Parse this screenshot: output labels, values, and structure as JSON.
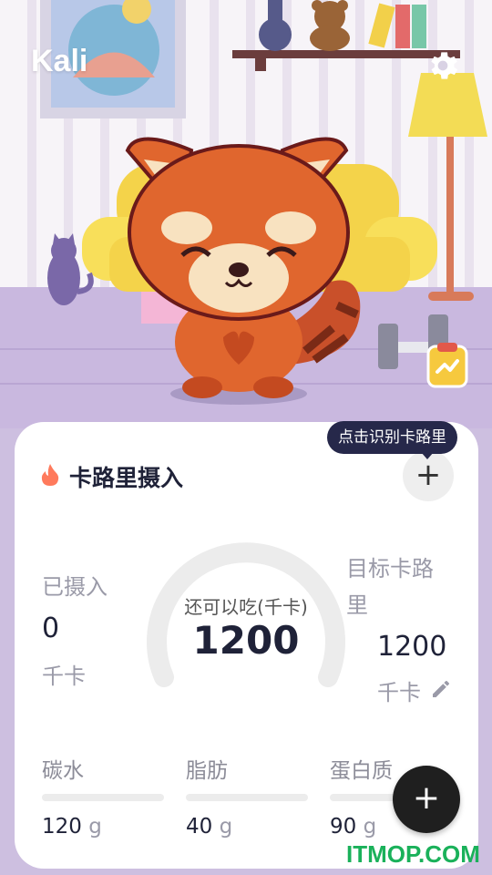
{
  "header": {
    "user_name": "Kali"
  },
  "colors": {
    "accent": "#26284a",
    "fire": "#ff7a5c",
    "brand_watermark": "#1ab15a"
  },
  "card": {
    "title": "卡路里摄入",
    "tooltip": "点击识别卡路里",
    "add_label": "+",
    "eaten": {
      "label": "已摄入",
      "value": "0",
      "unit": "千卡"
    },
    "remaining": {
      "label": "还可以吃(千卡)",
      "value": "1200",
      "fraction": 1.0
    },
    "goal": {
      "label": "目标卡路里",
      "value": "1200",
      "unit": "千卡"
    },
    "macros": [
      {
        "label": "碳水",
        "value": "120",
        "unit": "g",
        "fill": 0
      },
      {
        "label": "脂肪",
        "value": "40",
        "unit": "g",
        "fill": 0
      },
      {
        "label": "蛋白质",
        "value": "90",
        "unit": "g",
        "fill": 0
      }
    ]
  },
  "fab_label": "+",
  "watermark": "ITMOP.COM",
  "icons": [
    "gear-icon",
    "fire-icon",
    "edit-pencil-icon",
    "plus-icon",
    "clipboard-chart-icon"
  ]
}
